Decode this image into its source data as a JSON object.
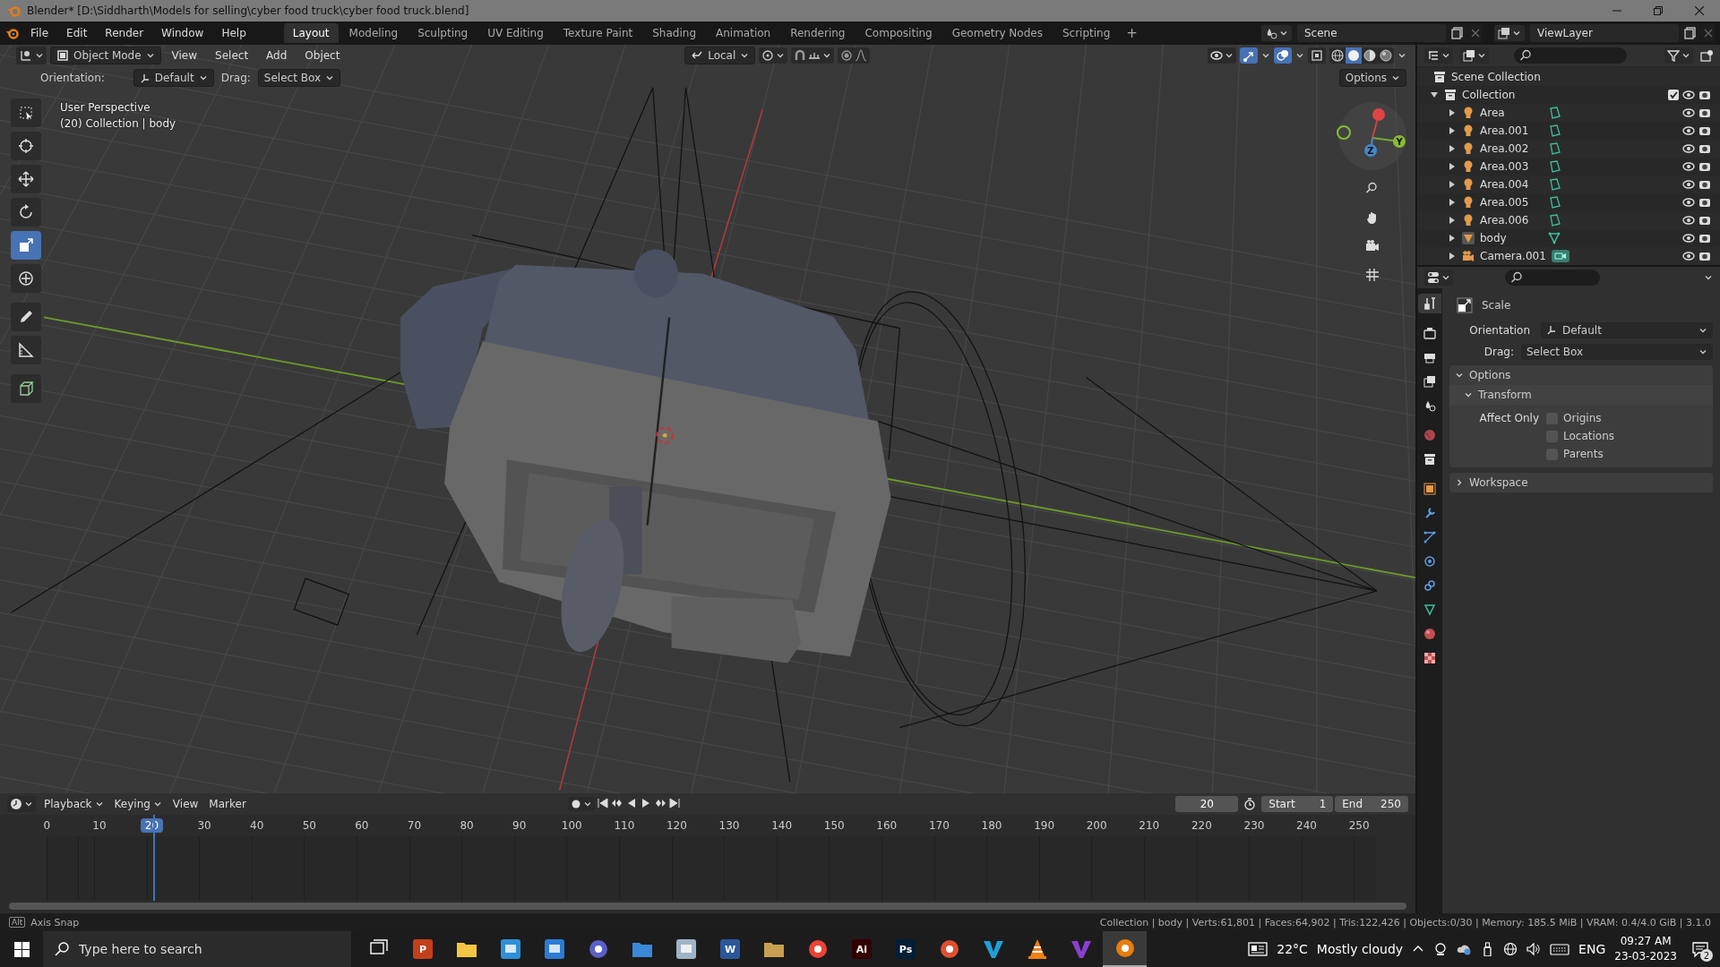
{
  "window": {
    "title": "Blender* [D:\\Siddharth\\Models for selling\\cyber food truck\\cyber food truck.blend]"
  },
  "menu": [
    "File",
    "Edit",
    "Render",
    "Window",
    "Help"
  ],
  "workspaces": [
    {
      "label": "Layout",
      "selected": true
    },
    {
      "label": "Modeling",
      "selected": false
    },
    {
      "label": "Sculpting",
      "selected": false
    },
    {
      "label": "UV Editing",
      "selected": false
    },
    {
      "label": "Texture Paint",
      "selected": false
    },
    {
      "label": "Shading",
      "selected": false
    },
    {
      "label": "Animation",
      "selected": false
    },
    {
      "label": "Rendering",
      "selected": false
    },
    {
      "label": "Compositing",
      "selected": false
    },
    {
      "label": "Geometry Nodes",
      "selected": false
    },
    {
      "label": "Scripting",
      "selected": false
    }
  ],
  "add_workspace": "+",
  "scene": "Scene",
  "view_layer": "ViewLayer",
  "viewport": {
    "mode": "Object Mode",
    "menus": [
      "View",
      "Select",
      "Add",
      "Object"
    ],
    "orientation_mode": "Local",
    "orientation_label": "Orientation:",
    "orientation": "Default",
    "drag_label": "Drag:",
    "drag": "Select Box",
    "options": "Options",
    "overlay": [
      "User Perspective",
      "(20) Collection | body"
    ],
    "tools": [
      {
        "kind": "select",
        "selected": false
      },
      {
        "kind": "cursor",
        "selected": false
      },
      {
        "kind": "move",
        "selected": false
      },
      {
        "kind": "rotate",
        "selected": false
      },
      {
        "kind": "scale",
        "selected": true
      },
      {
        "kind": "transform",
        "selected": false
      },
      {
        "kind": "annotate",
        "selected": false
      },
      {
        "kind": "measure",
        "selected": false
      },
      {
        "kind": "add_cube",
        "selected": false
      }
    ],
    "shading": [
      {
        "kind": "wireframe",
        "selected": false
      },
      {
        "kind": "solid",
        "selected": true
      },
      {
        "kind": "material",
        "selected": false
      },
      {
        "kind": "rendered",
        "selected": false
      }
    ],
    "gizmo_axes": [
      "Y",
      "Z"
    ]
  },
  "outliner": {
    "root": "Scene Collection",
    "collection": {
      "name": "Collection",
      "expanded": true,
      "checked": true,
      "children": [
        {
          "name": "Area",
          "kind": "light"
        },
        {
          "name": "Area.001",
          "kind": "light"
        },
        {
          "name": "Area.002",
          "kind": "light"
        },
        {
          "name": "Area.003",
          "kind": "light"
        },
        {
          "name": "Area.004",
          "kind": "light"
        },
        {
          "name": "Area.005",
          "kind": "light"
        },
        {
          "name": "Area.006",
          "kind": "light"
        },
        {
          "name": "body",
          "kind": "mesh"
        },
        {
          "name": "Camera.001",
          "kind": "camera"
        }
      ]
    }
  },
  "properties": {
    "tabs": [
      {
        "kind": "tool",
        "selected": true
      },
      {
        "kind": "render",
        "selected": false
      },
      {
        "kind": "output",
        "selected": false
      },
      {
        "kind": "view_layer",
        "selected": false
      },
      {
        "kind": "scene",
        "selected": false
      },
      {
        "kind": "world",
        "selected": false
      },
      {
        "kind": "collection",
        "selected": false
      },
      {
        "kind": "object",
        "selected": false
      },
      {
        "kind": "modifiers",
        "selected": false
      },
      {
        "kind": "particles",
        "selected": false
      },
      {
        "kind": "physics",
        "selected": false
      },
      {
        "kind": "constraints",
        "selected": false
      },
      {
        "kind": "data",
        "selected": false
      },
      {
        "kind": "material",
        "selected": false
      },
      {
        "kind": "texture",
        "selected": false
      }
    ],
    "tool": "Scale",
    "orientation_label": "Orientation",
    "orientation": "Default",
    "drag_label": "Drag:",
    "drag": "Select Box",
    "panels": [
      {
        "title": "Options",
        "expanded": true,
        "subpanels": [
          {
            "title": "Transform",
            "expanded": true,
            "label": "Affect Only",
            "options": [
              {
                "label": "Origins",
                "checked": false
              },
              {
                "label": "Locations",
                "checked": false
              },
              {
                "label": "Parents",
                "checked": false
              }
            ]
          }
        ]
      },
      {
        "title": "Workspace",
        "expanded": false
      }
    ]
  },
  "timeline": {
    "menus": [
      "Playback",
      "Keying",
      "View",
      "Marker"
    ],
    "current_frame": "20",
    "start_label": "Start",
    "start": "1",
    "end_label": "End",
    "end": "250",
    "ticks": [
      {
        "label": "0",
        "selected": false
      },
      {
        "label": "10",
        "selected": false
      },
      {
        "label": "20",
        "selected": true
      },
      {
        "label": "30",
        "selected": false
      },
      {
        "label": "40",
        "selected": false
      },
      {
        "label": "50",
        "selected": false
      },
      {
        "label": "60",
        "selected": false
      },
      {
        "label": "70",
        "selected": false
      },
      {
        "label": "80",
        "selected": false
      },
      {
        "label": "90",
        "selected": false
      },
      {
        "label": "100",
        "selected": false
      },
      {
        "label": "110",
        "selected": false
      },
      {
        "label": "120",
        "selected": false
      },
      {
        "label": "130",
        "selected": false
      },
      {
        "label": "140",
        "selected": false
      },
      {
        "label": "150",
        "selected": false
      },
      {
        "label": "160",
        "selected": false
      },
      {
        "label": "170",
        "selected": false
      },
      {
        "label": "180",
        "selected": false
      },
      {
        "label": "190",
        "selected": false
      },
      {
        "label": "200",
        "selected": false
      },
      {
        "label": "210",
        "selected": false
      },
      {
        "label": "220",
        "selected": false
      },
      {
        "label": "230",
        "selected": false
      },
      {
        "label": "240",
        "selected": false
      },
      {
        "label": "250",
        "selected": false
      }
    ]
  },
  "status_bar": {
    "key": "Alt",
    "hint": "Axis Snap",
    "stats": "Collection | body | Verts:61,801 | Faces:64,902 | Tris:122,426 | Objects:0/30 | Memory: 185.5 MiB | VRAM: 0.4/4.0 GiB | 3.1.0"
  },
  "taskbar": {
    "search_placeholder": "Type here to search",
    "apps": [
      {
        "kind": "taskview",
        "selected": false
      },
      {
        "kind": "tile",
        "color": "#c43e1c",
        "label": "P",
        "selected": false
      },
      {
        "kind": "folder",
        "color": "#f4c542",
        "selected": false
      },
      {
        "kind": "tile",
        "color": "#2f8fd8",
        "selected": false
      },
      {
        "kind": "tile",
        "color": "#2b7cd3",
        "selected": false
      },
      {
        "kind": "circle",
        "color": "#5b5fc7",
        "selected": false
      },
      {
        "kind": "folder",
        "color": "#3a88d8",
        "selected": false
      },
      {
        "kind": "tile",
        "color": "#a0b4c8",
        "selected": false
      },
      {
        "kind": "tile",
        "color": "#2b579a",
        "label": "W",
        "selected": false
      },
      {
        "kind": "folder",
        "color": "#c8a050",
        "selected": false
      },
      {
        "kind": "circle",
        "color": "#ea4335",
        "selected": false
      },
      {
        "kind": "tile",
        "color": "#330000",
        "label": "Ai",
        "selected": false
      },
      {
        "kind": "tile",
        "color": "#001e36",
        "label": "Ps",
        "selected": false
      },
      {
        "kind": "circle",
        "color": "#e05030",
        "selected": false
      },
      {
        "kind": "v",
        "color": "#1fa0d8",
        "selected": false
      },
      {
        "kind": "cone",
        "color": "#f08010",
        "selected": false
      },
      {
        "kind": "v",
        "color": "#8a40d0",
        "selected": false
      },
      {
        "kind": "circle",
        "color": "#e87d0d",
        "selected": true
      }
    ],
    "temperature": "22°C",
    "weather": "Mostly cloudy",
    "language": "ENG",
    "time": "09:27 AM",
    "date": "23-03-2023",
    "notifications": "2"
  }
}
